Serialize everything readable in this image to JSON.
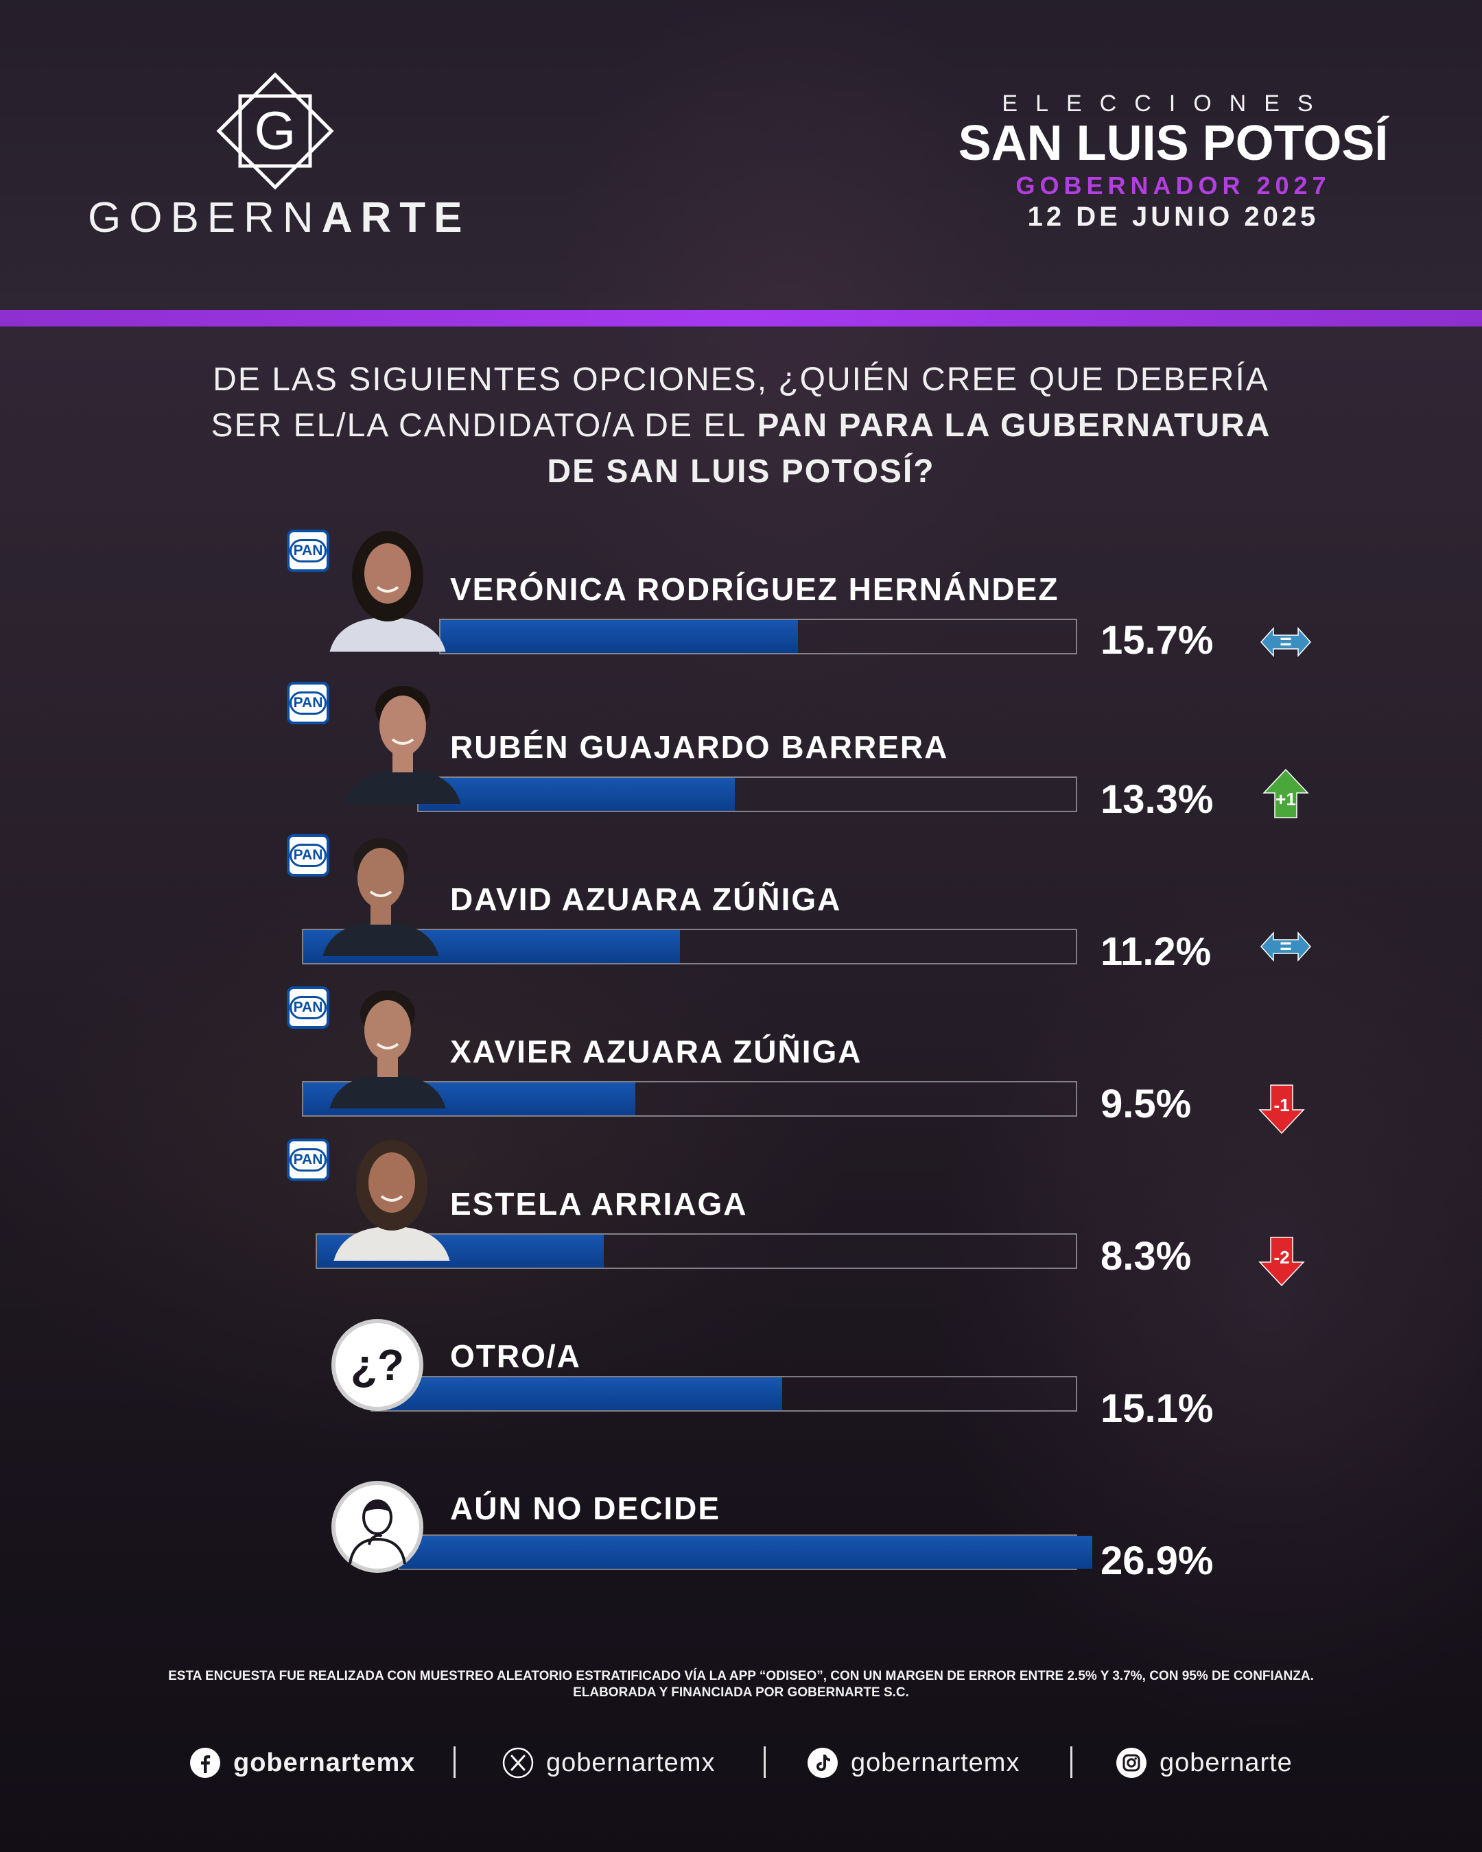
{
  "brand": {
    "logo_letter": "G",
    "name_light": "GOBERN",
    "name_strong": "ARTE"
  },
  "header": {
    "eyebrow": "ELECCIONES",
    "state": "SAN LUIS POTOSÍ",
    "office": "GOBERNADOR 2027",
    "date": "12 DE JUNIO 2025"
  },
  "question": {
    "part1": "DE LAS SIGUIENTES OPCIONES, ¿QUIÉN CREE QUE DEBERÍA SER EL/LA CANDIDATO/A DE EL",
    "part2": "PAN PARA LA GUBERNATURA DE SAN LUIS POTOSÍ?"
  },
  "party_badge_text": "PAN",
  "colors": {
    "accent_purple": "#a638f0",
    "bar_blue": "#0b3e8c",
    "trend_equal": "#3a8fc0",
    "trend_up": "#4aa83a",
    "trend_down": "#e0262a"
  },
  "chart_data": {
    "type": "bar",
    "orientation": "horizontal",
    "xlim": [
      0,
      100
    ],
    "categories": [
      "VERÓNICA RODRÍGUEZ HERNÁNDEZ",
      "RUBÉN GUAJARDO BARRERA",
      "DAVID AZUARA ZÚÑIGA",
      "XAVIER AZUARA ZÚÑIGA",
      "ESTELA ARRIAGA",
      "OTRO/A",
      "AÚN NO DECIDE"
    ],
    "values": [
      15.7,
      13.3,
      11.2,
      9.5,
      8.3,
      15.1,
      26.9
    ],
    "value_labels": [
      "15.7%",
      "13.3%",
      "11.2%",
      "9.5%",
      "8.3%",
      "15.1%",
      "26.9%"
    ],
    "party": [
      "PAN",
      "PAN",
      "PAN",
      "PAN",
      "PAN",
      "",
      ""
    ],
    "trend": [
      {
        "dir": "equal",
        "label": "="
      },
      {
        "dir": "up",
        "label": "+1"
      },
      {
        "dir": "equal",
        "label": "="
      },
      {
        "dir": "down",
        "label": "-1"
      },
      {
        "dir": "down",
        "label": "-2"
      },
      null,
      null
    ],
    "avatar_icons": [
      "candidate-photo",
      "candidate-photo",
      "candidate-photo",
      "candidate-photo",
      "candidate-photo",
      "question-icon",
      "undecided-person-icon"
    ],
    "other_glyph": "¿?"
  },
  "footnote": {
    "line1_a": "ESTA ENCUESTA FUE REALIZADA CON MUESTREO ALEATORIO ESTRATIFICADO VÍA LA ",
    "line1_b": "APP “ODISEO”",
    "line1_c": ", CON UN MARGEN DE ERROR ENTRE 2.5% Y 3.7%, CON ",
    "line1_d": "95% DE CONFIANZA.",
    "line2_a": "ELABORADA Y FINANCIADA POR ",
    "line2_b": "GOBERNARTE S.C."
  },
  "socials": [
    {
      "icon": "facebook-icon",
      "handle": "gobernartemx"
    },
    {
      "icon": "x-icon",
      "handle": "gobernartemx"
    },
    {
      "icon": "tiktok-icon",
      "handle": "gobernartemx"
    },
    {
      "icon": "instagram-icon",
      "handle": "gobernarte"
    }
  ]
}
